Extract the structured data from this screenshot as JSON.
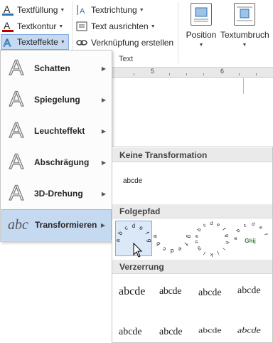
{
  "ribbon": {
    "text_fill": "Textfüllung",
    "text_outline": "Textkontur",
    "text_effects": "Texteffekte",
    "text_direction": "Textrichtung",
    "align_text": "Text ausrichten",
    "create_link": "Verknüpfung erstellen",
    "group_text": "Text",
    "position": "Position",
    "wrap_text": "Textumbruch"
  },
  "ruler": {
    "n5": "5",
    "n6": "6"
  },
  "menu": {
    "items": [
      {
        "label": "Schatten",
        "icon": "shadow-icon"
      },
      {
        "label": "Spiegelung",
        "icon": "reflection-icon"
      },
      {
        "label": "Leuchteffekt",
        "icon": "glow-icon"
      },
      {
        "label": "Abschrägung",
        "icon": "bevel-icon"
      },
      {
        "label": "3D-Drehung",
        "icon": "3d-rotation-icon"
      },
      {
        "label": "Transformieren",
        "icon": "transform-icon"
      }
    ]
  },
  "gallery": {
    "no_transform_header": "Keine Transformation",
    "no_transform_sample": "abcde",
    "follow_path_header": "Folgepfad",
    "warp_header": "Verzerrung",
    "warp_samples": [
      "abcde",
      "abcde",
      "abcde",
      "abcde",
      "abcde",
      "abcde",
      "abcde",
      "abcde"
    ],
    "arc1_letters": [
      "a",
      "b",
      "c",
      "d",
      "e",
      "f",
      "g"
    ],
    "arc2_letters": [
      "a",
      "b",
      "c",
      "d",
      "e",
      "f",
      "g"
    ],
    "circle_letters": [
      "a",
      "b",
      "c",
      "d",
      "e",
      "f",
      "g",
      "h",
      "i",
      "j",
      "k",
      "l",
      "m",
      "n"
    ],
    "button_letters": [
      "a",
      "b",
      "c",
      "d",
      "e",
      "f"
    ],
    "button_middle": "Ghij"
  },
  "colors": {
    "fill_accent": "#2e75b6",
    "outline_accent": "#c00000",
    "selection": "#c5d9f1"
  }
}
